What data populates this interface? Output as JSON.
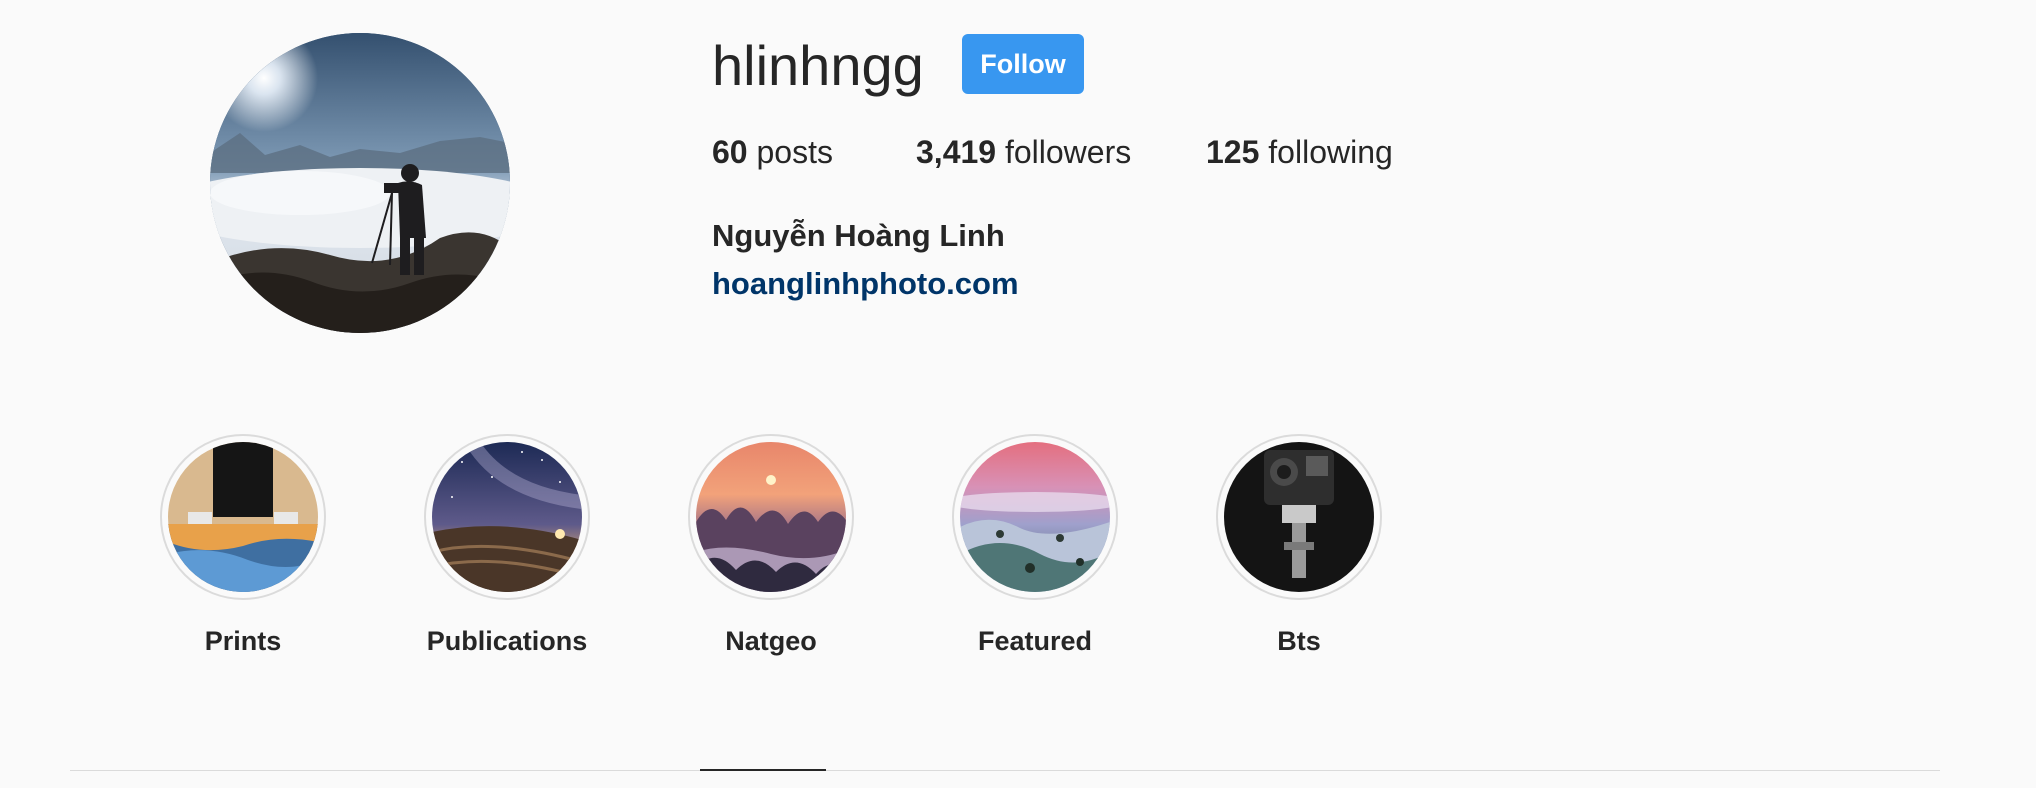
{
  "profile": {
    "username": "hlinhngg",
    "follow_label": "Follow",
    "stats": {
      "posts_count": "60",
      "posts_label": "posts",
      "followers_count": "3,419",
      "followers_label": "followers",
      "following_count": "125",
      "following_label": "following"
    },
    "full_name": "Nguyễn Hoàng Linh",
    "website": "hoanglinhphoto.com"
  },
  "highlights": [
    {
      "label": "Prints"
    },
    {
      "label": "Publications"
    },
    {
      "label": "Natgeo"
    },
    {
      "label": "Featured"
    },
    {
      "label": "Bts"
    }
  ],
  "colors": {
    "background": "#fafafa",
    "text": "#262626",
    "follow_button": "#3897f0",
    "link": "#003569",
    "ring": "#dbdbdb"
  }
}
